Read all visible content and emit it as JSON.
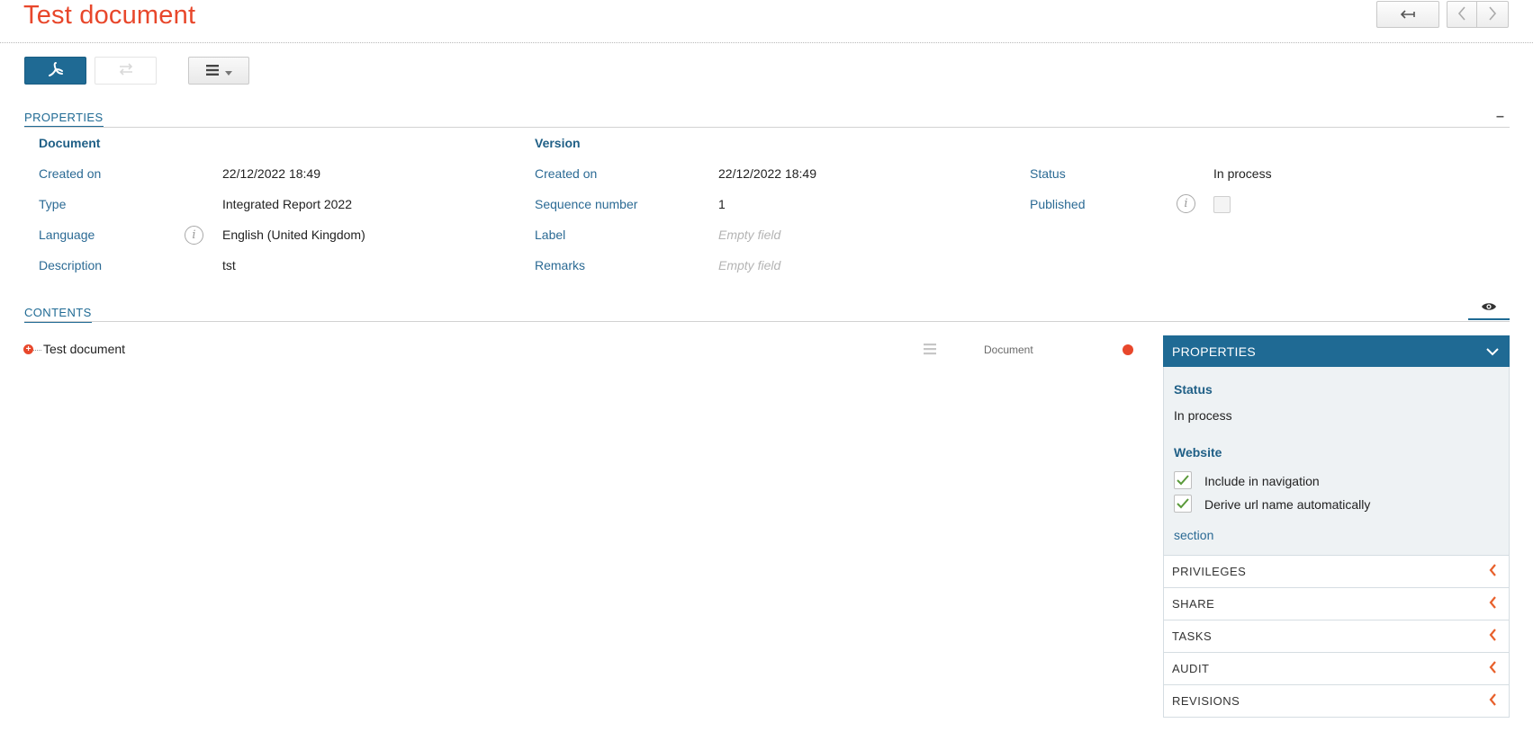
{
  "header": {
    "title": "Test document"
  },
  "toolbar": {
    "pdf_icon": "pdf-icon",
    "swap_icon": "swap-icon",
    "menu_icon": "hamburger-menu-icon"
  },
  "properties": {
    "section_title": "PROPERTIES",
    "document": {
      "heading": "Document",
      "created_on_label": "Created on",
      "created_on_value": "22/12/2022 18:49",
      "type_label": "Type",
      "type_value": "Integrated Report 2022",
      "language_label": "Language",
      "language_value": "English (United Kingdom)",
      "description_label": "Description",
      "description_value": "tst"
    },
    "version": {
      "heading": "Version",
      "created_on_label": "Created on",
      "created_on_value": "22/12/2022 18:49",
      "sequence_label": "Sequence number",
      "sequence_value": "1",
      "label_label": "Label",
      "label_value": "Empty field",
      "remarks_label": "Remarks",
      "remarks_value": "Empty field"
    },
    "status": {
      "status_label": "Status",
      "status_value": "In process",
      "published_label": "Published",
      "published_checked": false
    }
  },
  "contents": {
    "section_title": "CONTENTS",
    "rows": [
      {
        "name": "Test document",
        "type": "Document",
        "status_color": "#e8472b"
      }
    ]
  },
  "side_panel": {
    "properties_title": "PROPERTIES",
    "status_heading": "Status",
    "status_value": "In process",
    "website_heading": "Website",
    "include_in_navigation": "Include in navigation",
    "include_in_navigation_checked": true,
    "derive_url": "Derive url name automatically",
    "derive_url_checked": true,
    "section_link": "section",
    "accordion": [
      "PRIVILEGES",
      "SHARE",
      "TASKS",
      "AUDIT",
      "REVISIONS"
    ]
  },
  "colors": {
    "accent": "#1f6a94",
    "title": "#e8472b",
    "status_dot": "#e8472b",
    "check": "#5a9a3a"
  }
}
